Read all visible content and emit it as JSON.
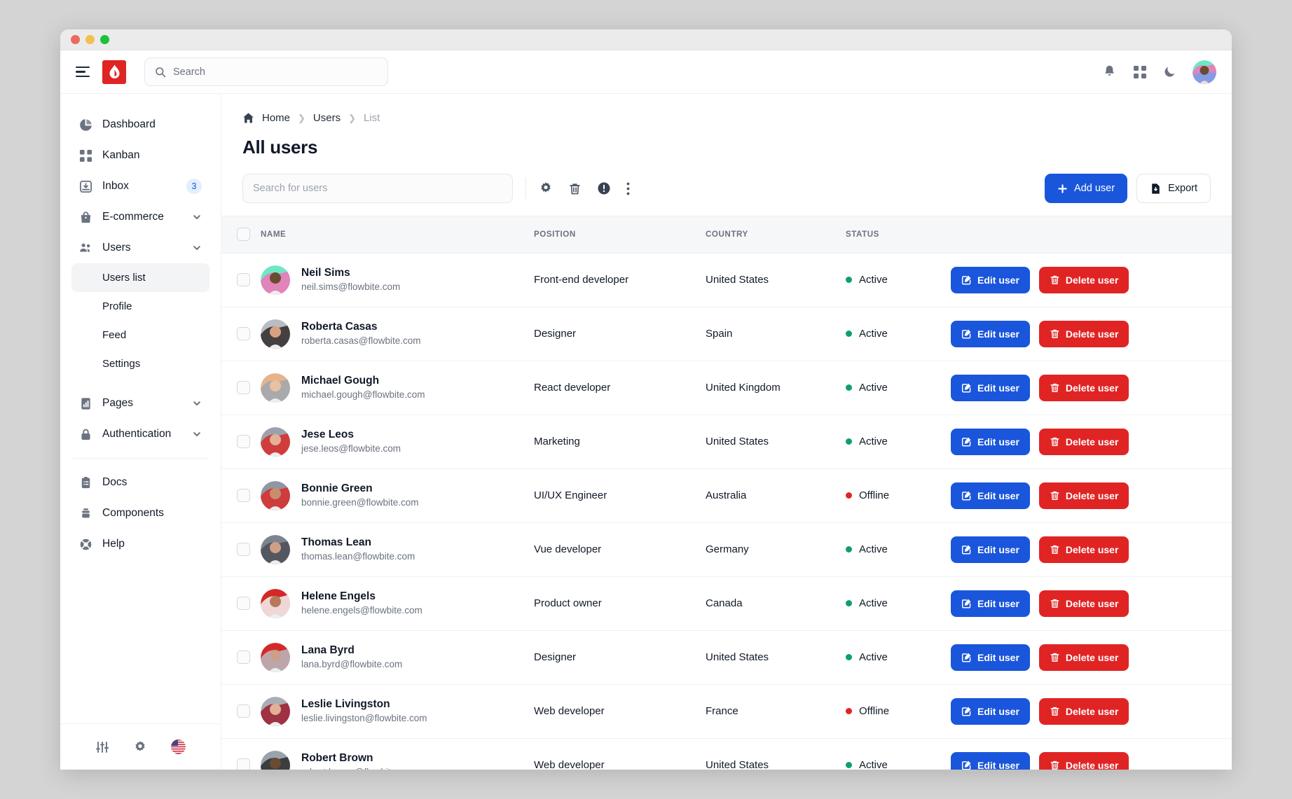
{
  "window": {
    "traffic_lights": [
      "close",
      "minimize",
      "maximize"
    ]
  },
  "navbar": {
    "menu_icon": "hamburger-icon",
    "brand_icon": "flowbite-flame-logo",
    "search": {
      "value": "",
      "placeholder": "Search",
      "icon": "search-icon"
    },
    "icons": [
      "bell-icon",
      "apps-grid-icon",
      "moon-dark-mode-icon"
    ],
    "avatar": "user-avatar"
  },
  "sidebar": {
    "items": [
      {
        "label": "Dashboard",
        "icon": "chart-pie-icon",
        "badge": null,
        "chevron": false
      },
      {
        "label": "Kanban",
        "icon": "grid-squares-icon",
        "badge": null,
        "chevron": false
      },
      {
        "label": "Inbox",
        "icon": "inbox-download-icon",
        "badge": "3",
        "chevron": false
      },
      {
        "label": "E-commerce",
        "icon": "shopping-bag-icon",
        "badge": null,
        "chevron": true
      },
      {
        "label": "Users",
        "icon": "users-group-icon",
        "badge": null,
        "chevron": true
      }
    ],
    "sub_items": [
      {
        "label": "Users list",
        "active": true
      },
      {
        "label": "Profile",
        "active": false
      },
      {
        "label": "Feed",
        "active": false
      },
      {
        "label": "Settings",
        "active": false
      }
    ],
    "items2": [
      {
        "label": "Pages",
        "icon": "pages-chart-icon",
        "badge": null,
        "chevron": true
      },
      {
        "label": "Authentication",
        "icon": "lock-icon",
        "badge": null,
        "chevron": true
      }
    ],
    "items3": [
      {
        "label": "Docs",
        "icon": "clipboard-docs-icon",
        "badge": null,
        "chevron": false
      },
      {
        "label": "Components",
        "icon": "components-stack-icon",
        "badge": null,
        "chevron": false
      },
      {
        "label": "Help",
        "icon": "lifebuoy-help-icon",
        "badge": null,
        "chevron": false
      }
    ],
    "footer_icons": [
      "adjustments-sliders-icon",
      "gear-settings-icon",
      "us-flag-icon"
    ]
  },
  "breadcrumb": {
    "home_icon": "home-icon",
    "items": [
      "Home",
      "Users",
      "List"
    ]
  },
  "page": {
    "title": "All users"
  },
  "toolbar": {
    "search": {
      "value": "",
      "placeholder": "Search for users"
    },
    "icons": [
      "gear-settings-icon",
      "trash-delete-icon",
      "exclamation-circle-icon",
      "dots-vertical-menu-icon"
    ],
    "add_user_label": "Add user",
    "add_user_icon": "plus-icon",
    "export_label": "Export",
    "export_icon": "file-download-icon"
  },
  "table": {
    "columns": [
      "NAME",
      "POSITION",
      "COUNTRY",
      "STATUS"
    ],
    "select_all_checked": false,
    "edit_label": "Edit user",
    "edit_icon": "pencil-square-icon",
    "delete_label": "Delete user",
    "delete_icon": "trash-icon",
    "status_colors": {
      "Active": "#0e9f6e",
      "Offline": "#e02424"
    },
    "rows": [
      {
        "name": "Neil Sims",
        "email": "neil.sims@flowbite.com",
        "position": "Front-end developer",
        "country": "United States",
        "status": "Active",
        "avatar_bg": "#6ee7c6",
        "avatar_fg": "#f472b6",
        "skin": "#6b4a32"
      },
      {
        "name": "Roberta Casas",
        "email": "roberta.casas@flowbite.com",
        "position": "Designer",
        "country": "Spain",
        "status": "Active",
        "avatar_bg": "#b9bcc2",
        "avatar_fg": "#2f2a28",
        "skin": "#d9a184"
      },
      {
        "name": "Michael Gough",
        "email": "michael.gough@flowbite.com",
        "position": "React developer",
        "country": "United Kingdom",
        "status": "Active",
        "avatar_bg": "#e6b48c",
        "avatar_fg": "#9fa7b2",
        "skin": "#e8c2a0"
      },
      {
        "name": "Jese Leos",
        "email": "jese.leos@flowbite.com",
        "position": "Marketing",
        "country": "United States",
        "status": "Active",
        "avatar_bg": "#9aa3ad",
        "avatar_fg": "#d92b2b",
        "skin": "#e3b193"
      },
      {
        "name": "Bonnie Green",
        "email": "bonnie.green@flowbite.com",
        "position": "UI/UX Engineer",
        "country": "Australia",
        "status": "Offline",
        "avatar_bg": "#8e97a3",
        "avatar_fg": "#d92b2b",
        "skin": "#c98d6b"
      },
      {
        "name": "Thomas Lean",
        "email": "thomas.lean@flowbite.com",
        "position": "Vue developer",
        "country": "Germany",
        "status": "Active",
        "avatar_bg": "#7d8490",
        "avatar_fg": "#4a4f58",
        "skin": "#cfa085"
      },
      {
        "name": "Helene Engels",
        "email": "helene.engels@flowbite.com",
        "position": "Product owner",
        "country": "Canada",
        "status": "Active",
        "avatar_bg": "#d42828",
        "avatar_fg": "#f3f4f6",
        "skin": "#b57a59"
      },
      {
        "name": "Lana Byrd",
        "email": "lana.byrd@flowbite.com",
        "position": "Designer",
        "country": "United States",
        "status": "Active",
        "avatar_bg": "#d42828",
        "avatar_fg": "#b9bcc2",
        "skin": "#caa088"
      },
      {
        "name": "Leslie Livingston",
        "email": "leslie.livingston@flowbite.com",
        "position": "Web developer",
        "country": "France",
        "status": "Offline",
        "avatar_bg": "#a9aeb6",
        "avatar_fg": "#9c1b2e",
        "skin": "#e0b193"
      },
      {
        "name": "Robert Brown",
        "email": "robert.brown@flowbite.com",
        "position": "Web developer",
        "country": "United States",
        "status": "Active",
        "avatar_bg": "#9aa3ad",
        "avatar_fg": "#2b2b2b",
        "skin": "#6b4a32"
      }
    ]
  }
}
